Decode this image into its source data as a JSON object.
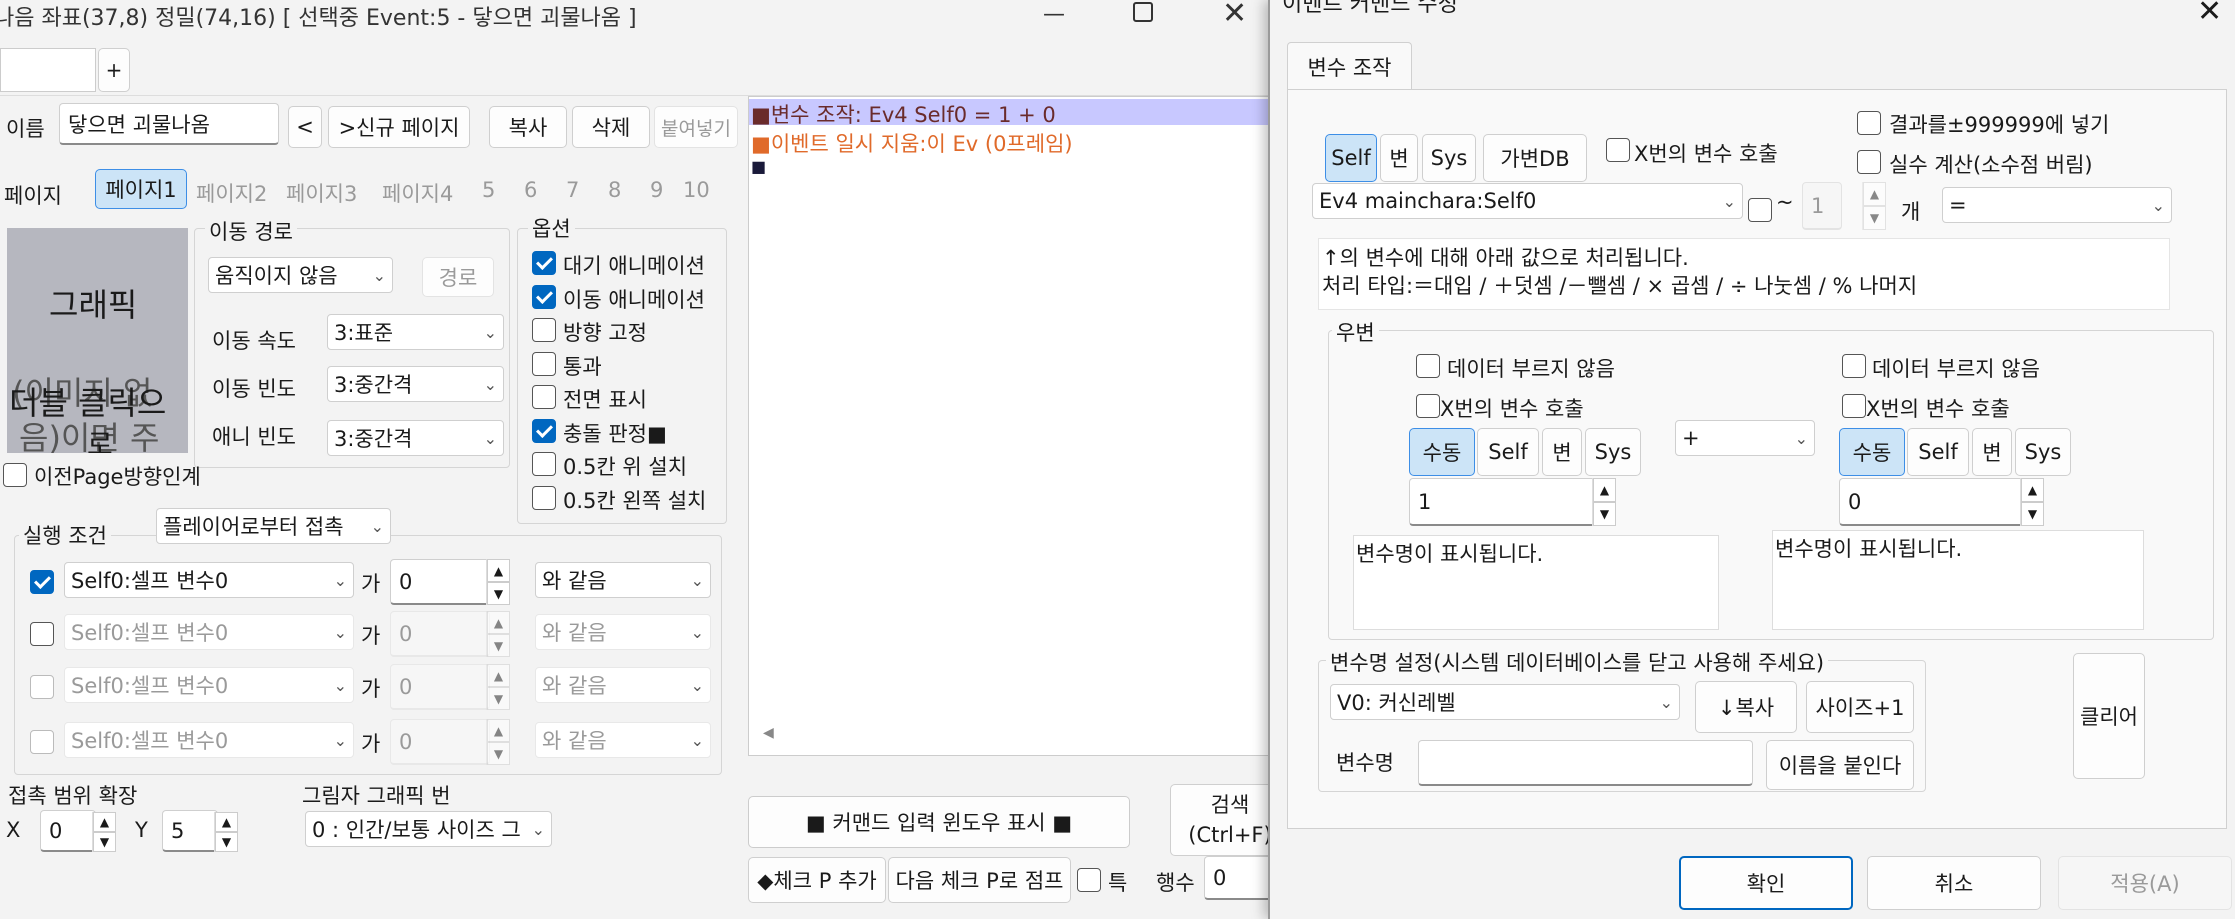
{
  "main_window": {
    "title": "나음 좌표(37,8) 정밀(74,16) [ 선택중 Event:5 - 닿으면 괴물나옴 ]",
    "plus": "+",
    "name_label": "이름",
    "name_value": "닿으면 괴물나옴",
    "prev_btn": "<",
    "new_page_btn": ">신규 페이지",
    "copy_btn": "복사",
    "delete_btn": "삭제",
    "paste_btn": "붙여넣기",
    "page_label": "페이지",
    "pages": [
      "페이지1",
      "페이지2",
      "페이지3",
      "페이지4",
      "5",
      "6",
      "7",
      "8",
      "9",
      "10"
    ],
    "graphic_label": "그래픽",
    "graphic_sub1": "(이미지 없",
    "graphic_sub2": "음)이면 주",
    "graphic_dbl": "더블 클릭으",
    "graphic_dbl2": "로",
    "move_route": {
      "title": "이동 경로",
      "type": "움직이지 않음",
      "route_btn": "경로",
      "speed_label": "이동 속도",
      "speed": "3:표준",
      "freq_label": "이동 빈도",
      "freq": "3:중간격",
      "anim_label": "애니 빈도",
      "anim": "3:중간격"
    },
    "options": {
      "title": "옵션",
      "items": [
        {
          "label": "대기 애니메이션",
          "checked": true
        },
        {
          "label": "이동 애니메이션",
          "checked": true
        },
        {
          "label": "방향 고정",
          "checked": false
        },
        {
          "label": "통과",
          "checked": false
        },
        {
          "label": "전면 표시",
          "checked": false
        },
        {
          "label": "충돌 판정■",
          "checked": true
        },
        {
          "label": "0.5칸 위 설치",
          "checked": false
        },
        {
          "label": "0.5칸 왼쪽 설치",
          "checked": false
        }
      ]
    },
    "prev_page_dir": "이전Page방향인계",
    "exec": {
      "title": "실행 조건",
      "trigger": "플레이어로부터 접촉",
      "conds": [
        {
          "var": "Self0:셀프 변수0",
          "ga": "가",
          "val": "0",
          "op": "와 같음"
        },
        {
          "var": "Self0:셀프 변수0",
          "ga": "가",
          "val": "0",
          "op": "와 같음"
        },
        {
          "var": "Self0:셀프 변수0",
          "ga": "가",
          "val": "0",
          "op": "와 같음"
        },
        {
          "var": "Self0:셀프 변수0",
          "ga": "가",
          "val": "0",
          "op": "와 같음"
        }
      ]
    },
    "contact_label": "접촉 범위 확장",
    "x_label": "X",
    "x_val": "0",
    "y_label": "Y",
    "y_val": "5",
    "shadow_label": "그림자 그래픽 번",
    "shadow_val": "0 : 인간/보통 사이즈 그",
    "commands": [
      "■변수 조작: Ev4 Self0 = 1 + 0",
      "■이벤트 일시 지움:이 Ev (0프레임)",
      "■"
    ],
    "cmd_window_btn": "■  커맨드 입력 윈도우 표시  ■",
    "search_btn1": "검색",
    "search_btn2": "(Ctrl+F)",
    "check_add_btn": "◆체크 P 추가",
    "next_check_btn": "다음 체크 P로 점프",
    "special": "특",
    "line_label": "행수",
    "line_val": "0"
  },
  "dialog": {
    "title": "이벤트 커맨드 수정",
    "close": "✕",
    "tab": "변수 조작",
    "type_btns": [
      "Self",
      "변",
      "Sys",
      "가변DB"
    ],
    "x_call": "X번의 변수 호출",
    "result_clamp": "결과를±999999에 넣기",
    "real_calc": "실수 계산(소수점 버림)",
    "target": "Ev4 mainchara:Self0",
    "tilde": "~",
    "count": "1",
    "count_unit": "개",
    "assign_op": "=",
    "desc1": "↑의 변수에 대해 아래 값으로 처리됩니다.",
    "desc2": "처리 타입:＝대입 / ＋덧셈 /－뺄셈 / × 곱셈 / ÷ 나눗셈 / % 나머지",
    "rhs_title": "우변",
    "no_data": "데이터 부르지 않음",
    "left_btns": [
      "수동",
      "Self",
      "변",
      "Sys"
    ],
    "left_val": "1",
    "op": "+",
    "right_val": "0",
    "var_hint": "변수명이 표시됩니다.",
    "varname_title": "변수명 설정(시스템 데이터베이스를 닫고 사용해 주세요)",
    "varname_sel": "V0: 커신레벨",
    "copy_btn": "↓복사",
    "size_btn": "사이즈+1",
    "varname_label": "변수명",
    "name_btn": "이름을 붙인다",
    "clear_btn": "클리어",
    "ok": "확인",
    "cancel": "취소",
    "apply": "적용(A)"
  }
}
